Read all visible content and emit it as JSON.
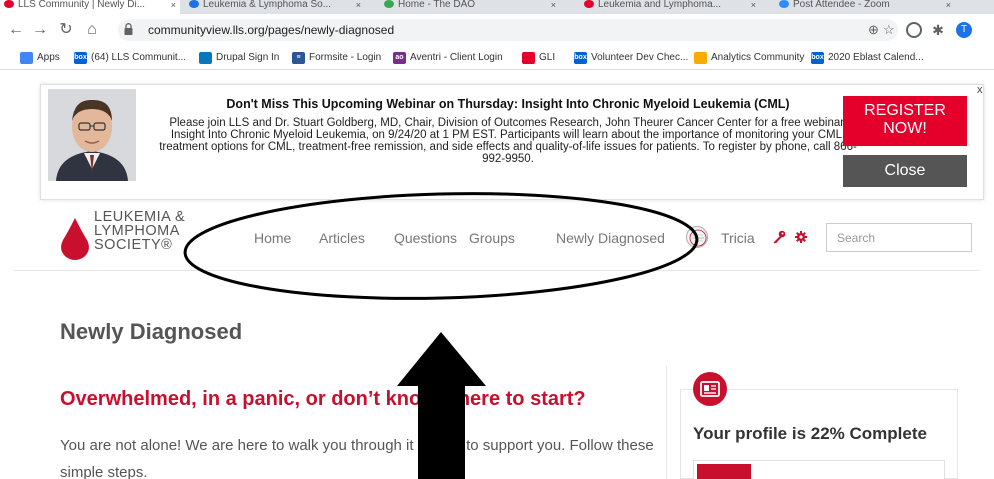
{
  "browser": {
    "tabs": [
      {
        "label": "LLS Community | Newly Di...",
        "color": "#e4002b",
        "active": true
      },
      {
        "label": "Leukemia & Lymphoma So...",
        "color": "#1a73e8",
        "active": false
      },
      {
        "label": "Home - The DAO",
        "color": "#34a853",
        "active": false
      },
      {
        "label": "Leukemia and Lymphoma...",
        "color": "#e4002b",
        "active": false
      },
      {
        "label": "Post Attendee - Zoom",
        "color": "#2d8cff",
        "active": false
      }
    ],
    "url": "communityview.lls.org/pages/newly-diagnosed",
    "profile_initial": "T",
    "bookmarks": [
      {
        "label": "Apps",
        "icon": "apps-grid-icon",
        "color": "#4285f4",
        "badge": ""
      },
      {
        "label": "(64) LLS Communit...",
        "icon": "box-icon",
        "color": "#0061d5",
        "badge": "box"
      },
      {
        "label": "Drupal Sign In",
        "icon": "drupal-icon",
        "color": "#0678be",
        "badge": ""
      },
      {
        "label": "Formsite - Login",
        "icon": "formsite-icon",
        "color": "#2b5797",
        "badge": "≡"
      },
      {
        "label": "Aventri - Client Login",
        "icon": "aventri-icon",
        "color": "#7b2d8e",
        "badge": "ao"
      },
      {
        "label": "GLI",
        "icon": "drop-icon",
        "color": "#e4002b",
        "badge": ""
      },
      {
        "label": "Volunteer Dev Chec...",
        "icon": "box-icon",
        "color": "#0061d5",
        "badge": "box"
      },
      {
        "label": "Analytics Community",
        "icon": "analytics-icon",
        "color": "#f9ab00",
        "badge": ""
      },
      {
        "label": "2020 Eblast Calend...",
        "icon": "box-icon",
        "color": "#0061d5",
        "badge": "box"
      }
    ]
  },
  "banner": {
    "title": "Don't Miss This Upcoming Webinar on Thursday: Insight Into Chronic Myeloid Leukemia (CML)",
    "body": "Please join LLS and Dr. Stuart Goldberg, MD, Chair, Division of Outcomes Research, John Theurer Cancer Center for a free webinar, Insight Into Chronic Myeloid Leukemia, on 9/24/20 at 1 PM EST. Participants will learn about the importance of monitoring your CML, treatment options for CML, treatment-free remission, and side effects and quality-of-life issues for patients. To register by phone, call 866-992-9950.",
    "register_label": "REGISTER NOW!",
    "close_label": "Close",
    "dismiss_label": "x"
  },
  "site": {
    "logo_text": "LEUKEMIA &\nLYMPHOMA\nSOCIETY®",
    "brand_color": "#c8102e",
    "nav": [
      {
        "label": "Home"
      },
      {
        "label": "Articles"
      },
      {
        "label": "Questions"
      },
      {
        "label": "Groups"
      },
      {
        "label": "Newly Diagnosed"
      }
    ],
    "username": "Tricia",
    "search_placeholder": "Search"
  },
  "content": {
    "page_title": "Newly Diagnosed",
    "intro_heading": "Overwhelmed, in a panic, or don’t know where to start?",
    "intro_text": "You are not alone! We are here to walk you through it all and to support you. Follow these simple steps."
  },
  "profile": {
    "title": "Your profile is 22% Complete",
    "percent_complete": 22
  }
}
